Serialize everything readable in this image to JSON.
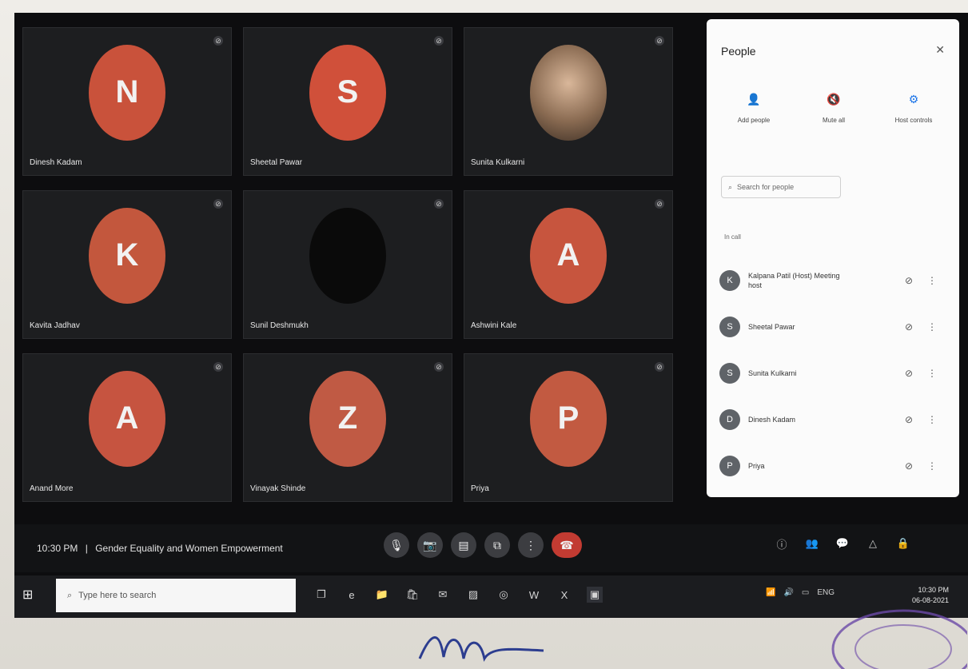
{
  "grid": {
    "tiles": [
      {
        "initial": "N",
        "name": "Dinesh Kadam",
        "avatar_color": "#c9523b",
        "photo": false
      },
      {
        "initial": "S",
        "name": "Sheetal Pawar",
        "avatar_color": "#d0503a",
        "photo": false
      },
      {
        "initial": "",
        "name": "Sunita Kulkarni",
        "avatar_color": "#8a6b52",
        "photo": true
      },
      {
        "initial": "K",
        "name": "Kavita Jadhav",
        "avatar_color": "#c3573d",
        "photo": false
      },
      {
        "initial": "",
        "name": "Sunil Deshmukh",
        "avatar_color": "#0a0a0a",
        "photo": false
      },
      {
        "initial": "A",
        "name": "Ashwini Kale",
        "avatar_color": "#c7553e",
        "photo": false
      },
      {
        "initial": "A",
        "name": "Anand More",
        "avatar_color": "#c65440",
        "photo": false
      },
      {
        "initial": "Z",
        "name": "Vinayak Shinde",
        "avatar_color": "#c05a44",
        "photo": false
      },
      {
        "initial": "P",
        "name": "Priya",
        "avatar_color": "#c25a41",
        "photo": false
      }
    ]
  },
  "meeting": {
    "time": "10:30 PM",
    "separator": "|",
    "title": "Gender Equality and Women Empowerment",
    "controls": [
      "mic-icon",
      "camera-icon",
      "captions-icon",
      "present-icon",
      "more-icon",
      "end-call-icon"
    ],
    "right_controls": [
      "info-icon",
      "people-icon",
      "chat-icon",
      "activities-icon",
      "host-icon"
    ]
  },
  "panel": {
    "title": "People",
    "actions": [
      {
        "label": "Add people",
        "icon": "add-person-icon"
      },
      {
        "label": "Mute all",
        "icon": "mute-all-icon"
      },
      {
        "label": "Host controls",
        "icon": "host-controls-icon"
      }
    ],
    "search_placeholder": "Search for people",
    "section_label": "In call",
    "people": [
      {
        "initial": "K",
        "name": "Kalpana Patil (Host) Meeting host"
      },
      {
        "initial": "S",
        "name": "Sheetal Pawar"
      },
      {
        "initial": "S",
        "name": "Sunita Kulkarni"
      },
      {
        "initial": "D",
        "name": "Dinesh Kadam"
      },
      {
        "initial": "P",
        "name": "Priya"
      }
    ]
  },
  "taskbar": {
    "search_placeholder": "Type here to search",
    "apps": [
      "task-view-icon",
      "edge-icon",
      "explorer-icon",
      "store-icon",
      "mail-icon",
      "photos-icon",
      "chrome-icon",
      "word-icon",
      "excel-icon",
      "meet-icon"
    ],
    "tray": [
      "network-icon",
      "volume-icon",
      "battery-icon",
      "language-icon"
    ],
    "clock_time": "10:30 PM",
    "clock_date": "06-08-2021"
  }
}
